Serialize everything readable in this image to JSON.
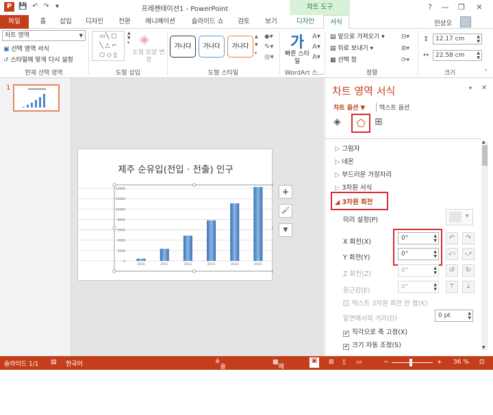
{
  "window": {
    "title": "프레젠테이션1 - PowerPoint",
    "context_tab": "차트 도구",
    "user": "전상오",
    "help": "?",
    "minimize": "—",
    "restore": "❐",
    "close": "✕"
  },
  "qat": {
    "app_icon": "P",
    "save": "💾",
    "undo": "↶",
    "redo": "↷",
    "customize": "▾"
  },
  "tabs": [
    "파일",
    "홈",
    "삽입",
    "디자인",
    "전환",
    "애니메이션",
    "슬라이드 쇼",
    "검토",
    "보기",
    "디자인",
    "서식"
  ],
  "ribbon": {
    "current_selection": {
      "combo": "차트 영역",
      "format_selection": "선택 영역 서식",
      "reset_style": "스타일에 맞게 다시 설정",
      "label": "현재 선택 영역"
    },
    "insert_shapes": {
      "change_shape": "도형 모양 변경",
      "label": "도형 삽입"
    },
    "shape_styles": {
      "presets": [
        "가나다",
        "가나다",
        "가나다"
      ],
      "label": "도형 스타일"
    },
    "wordart": {
      "quick_styles": "빠른 스타일",
      "glyph": "가",
      "label": "WordArt 스..."
    },
    "arrange": {
      "bring_forward": "앞으로 가져오기",
      "send_backward": "뒤로 보내기",
      "selection_pane": "선택 창",
      "label": "정렬"
    },
    "size": {
      "height": "12.17 cm",
      "width": "22.58 cm",
      "label": "크기"
    }
  },
  "slides": {
    "number": "1"
  },
  "chart": {
    "title": "제주 순유입(전입 · 전출) 인구"
  },
  "chart_data": {
    "type": "bar",
    "categories": [
      "2010",
      "2011",
      "2012",
      "2013",
      "2014",
      "2015"
    ],
    "values": [
      437,
      2343,
      4876,
      7823,
      11112,
      14257
    ],
    "ylim": [
      0,
      14000
    ],
    "yticks": [
      "0",
      "2000",
      "4000",
      "6000",
      "8000",
      "10000",
      "12000",
      "14000"
    ],
    "title": "제주 순유입(전입 · 전출) 인구"
  },
  "chart_buttons": {
    "elements": "+",
    "styles": "🖌",
    "filters": "▼"
  },
  "pane": {
    "title": "차트 영역 서식",
    "chart_options": "차트 옵션 ▼",
    "text_options": "텍스트 옵션",
    "sections": [
      "그림자",
      "네온",
      "부드러운 가장자리",
      "3차원 서식"
    ],
    "rotation_section": "3차원 회전",
    "preset_label": "미리 설정(P)",
    "x_rotation_label": "X 회전(X)",
    "x_rotation_value": "0°",
    "y_rotation_label": "Y 회전(Y)",
    "y_rotation_value": "0°",
    "z_rotation_label": "Z 회전(Z)",
    "z_rotation_value": "0°",
    "perspective_label": "원근감(E)",
    "perspective_value": "0°",
    "keep_text_flat": "텍스트 3차원 회전 안 함(K)",
    "distance_label": "밑면에서의 거리(D)",
    "distance_value": "0 pt",
    "right_angle_axes": "직각으로 축 고정(X)",
    "autoscale": "크기 자동 조정(S)"
  },
  "status": {
    "slide": "슬라이드 1/1",
    "language": "한국어",
    "notes": "슬라이드 노트",
    "comments": "메모",
    "zoom": "36 %"
  },
  "colors": {
    "accent": "#c43e1c",
    "context": "#217346",
    "bar": "#4a86c8",
    "highlight": "#d9292b"
  }
}
